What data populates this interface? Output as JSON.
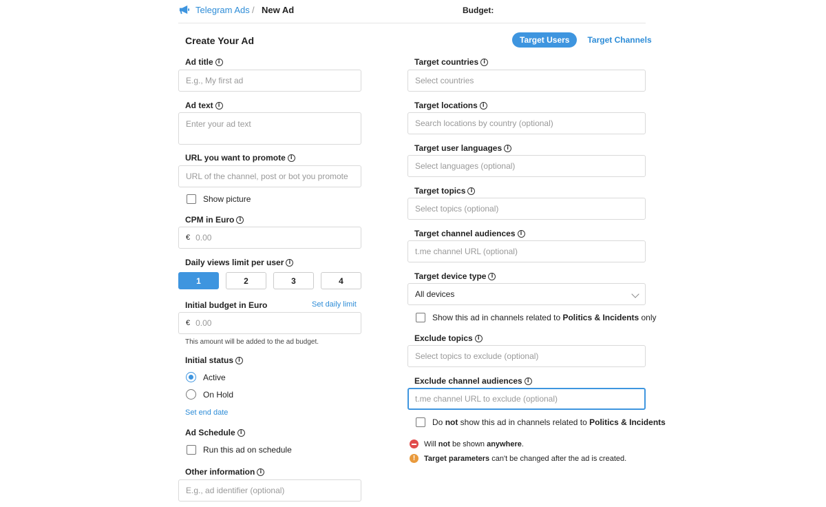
{
  "header": {
    "brand": "Telegram Ads",
    "separator": "/",
    "current": "New Ad",
    "budget_label": "Budget:"
  },
  "page": {
    "title": "Create Your Ad"
  },
  "tabs": [
    {
      "label": "Target Users",
      "active": true
    },
    {
      "label": "Target Channels",
      "active": false
    }
  ],
  "left": {
    "ad_title": {
      "label": "Ad title",
      "placeholder": "E.g., My first ad"
    },
    "ad_text": {
      "label": "Ad text",
      "placeholder": "Enter your ad text"
    },
    "url": {
      "label": "URL you want to promote",
      "placeholder": "URL of the channel, post or bot you promote"
    },
    "show_picture": "Show picture",
    "cpm": {
      "label": "CPM in Euro",
      "currency": "€",
      "placeholder": "0.00"
    },
    "daily_views": {
      "label": "Daily views limit per user",
      "options": [
        "1",
        "2",
        "3",
        "4"
      ],
      "selected": "1"
    },
    "initial_budget": {
      "label": "Initial budget in Euro",
      "link": "Set daily limit",
      "currency": "€",
      "placeholder": "0.00",
      "note": "This amount will be added to the ad budget."
    },
    "initial_status": {
      "label": "Initial status",
      "options": [
        "Active",
        "On Hold"
      ],
      "selected": "Active"
    },
    "set_end_date": "Set end date",
    "ad_schedule": {
      "label": "Ad Schedule",
      "checkbox": "Run this ad on schedule"
    },
    "other_info": {
      "label": "Other information",
      "placeholder": "E.g., ad identifier (optional)"
    }
  },
  "right": {
    "countries": {
      "label": "Target countries",
      "placeholder": "Select countries"
    },
    "locations": {
      "label": "Target locations",
      "placeholder": "Search locations by country (optional)"
    },
    "languages": {
      "label": "Target user languages",
      "placeholder": "Select languages (optional)"
    },
    "topics": {
      "label": "Target topics",
      "placeholder": "Select topics (optional)"
    },
    "channel_audiences": {
      "label": "Target channel audiences",
      "placeholder": "t.me channel URL (optional)"
    },
    "device": {
      "label": "Target device type",
      "value": "All devices"
    },
    "politics_only": {
      "prefix": "Show this ad in channels related to ",
      "bold": "Politics & Incidents",
      "suffix": " only"
    },
    "exclude_topics": {
      "label": "Exclude topics",
      "placeholder": "Select topics to exclude (optional)"
    },
    "exclude_audiences": {
      "label": "Exclude channel audiences",
      "placeholder": "t.me channel URL to exclude (optional)"
    },
    "politics_exclude": {
      "prefix": "Do ",
      "bold1": "not",
      "middle": " show this ad in channels related to ",
      "bold2": "Politics & Incidents"
    },
    "notice_shown": {
      "prefix": "Will ",
      "bold1": "not",
      "middle": " be shown ",
      "bold2": "anywhere",
      "suffix": "."
    },
    "notice_params": {
      "bold": "Target parameters",
      "rest": " can't be changed after the ad is created."
    }
  },
  "colors": {
    "accent": "#3e95df",
    "link": "#2d8cd7",
    "error": "#e14c4c",
    "warning": "#e99a3c"
  }
}
